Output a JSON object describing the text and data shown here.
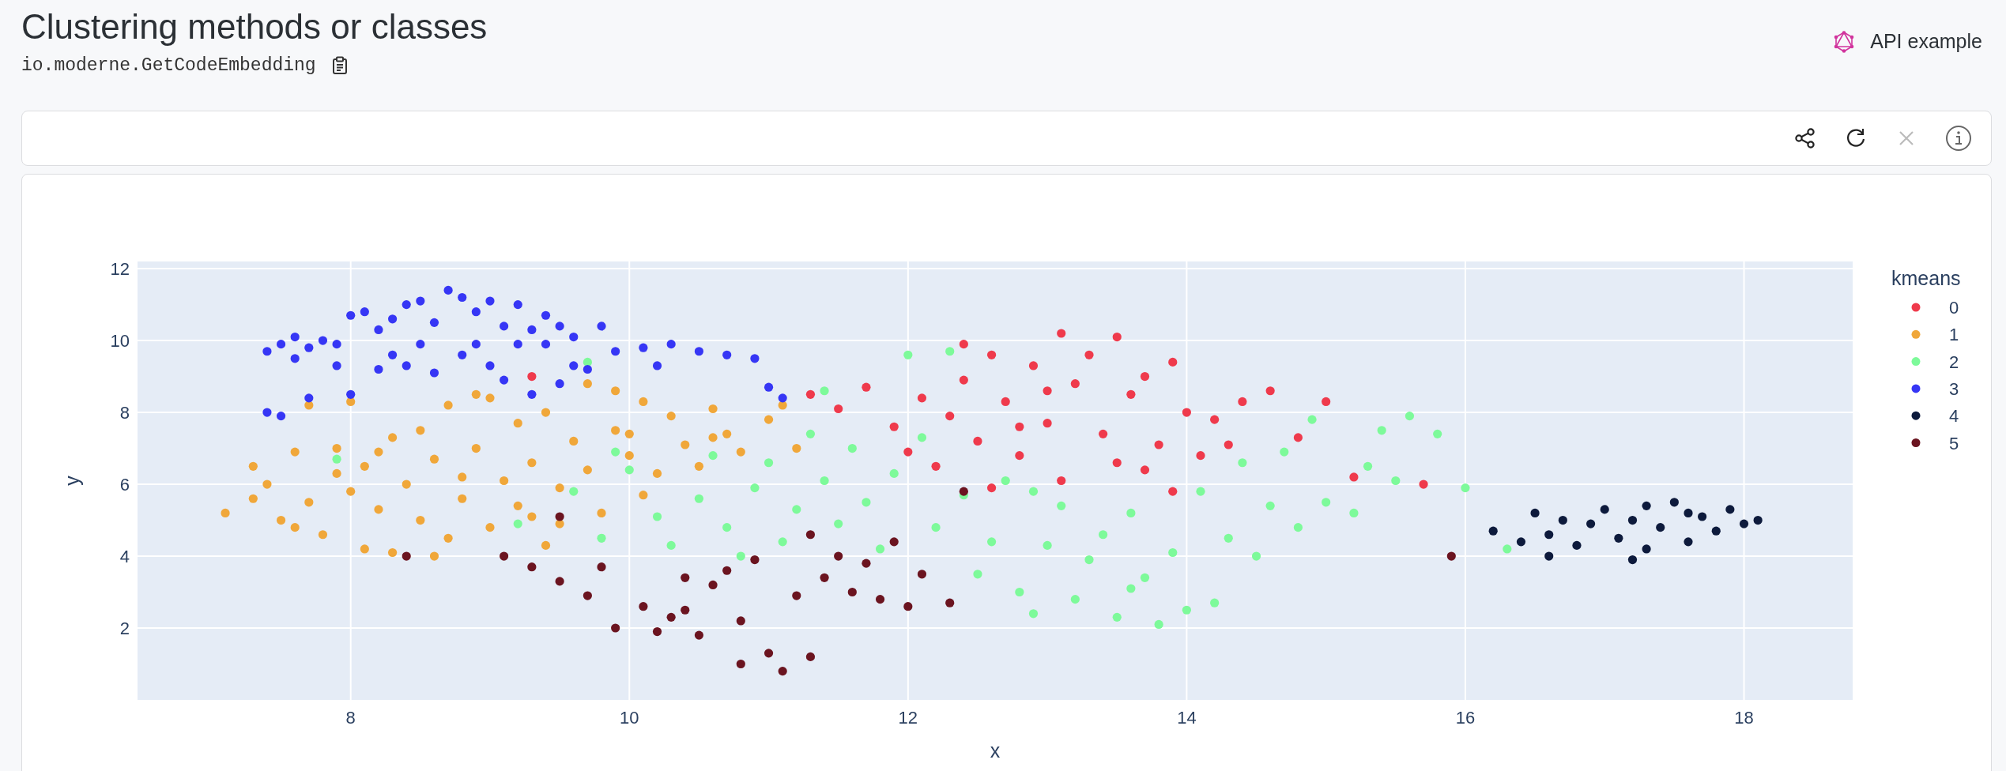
{
  "header": {
    "title": "Clustering methods or classes",
    "subtitle": "io.moderne.GetCodeEmbedding",
    "link": "API example"
  },
  "toolbar": [
    {
      "kind": "share",
      "disabled": false
    },
    {
      "kind": "refresh",
      "disabled": false
    },
    {
      "kind": "close",
      "disabled": true
    },
    {
      "kind": "info",
      "disabled": false
    }
  ],
  "chart": {
    "chart_data": {
      "type": "scatter",
      "xlabel": "x",
      "ylabel": "y",
      "grid": true,
      "legend": {
        "title": "kmeans"
      },
      "xlim": [
        6.47,
        18.78
      ],
      "ylim": [
        0,
        12.2
      ],
      "xticks": [
        8,
        10,
        12,
        14,
        16,
        18
      ],
      "yticks": [
        2,
        4,
        6,
        8,
        10,
        12
      ],
      "series": [
        {
          "name": "0",
          "color": "#ef3a4c",
          "x": [
            11.3,
            11.5,
            11.7,
            11.9,
            12.1,
            12.2,
            12.3,
            12.4,
            12.5,
            12.6,
            12.7,
            12.8,
            12.9,
            13.0,
            13.1,
            13.1,
            13.2,
            13.3,
            13.4,
            13.5,
            13.5,
            13.6,
            13.7,
            13.8,
            13.9,
            14.0,
            14.1,
            14.2,
            14.4,
            14.6,
            14.8,
            15.0,
            15.2,
            15.7,
            12.0,
            12.6,
            13.9,
            14.3,
            12.4,
            13.0,
            13.7,
            12.8,
            9.3
          ],
          "values": [
            8.5,
            8.1,
            8.7,
            7.6,
            8.4,
            6.5,
            7.9,
            8.9,
            7.2,
            9.6,
            8.3,
            6.8,
            9.3,
            7.7,
            10.2,
            6.1,
            8.8,
            9.6,
            7.4,
            10.1,
            6.6,
            8.5,
            9.0,
            7.1,
            9.4,
            8.0,
            6.8,
            7.8,
            8.3,
            8.6,
            7.3,
            8.3,
            6.2,
            6.0,
            6.9,
            5.9,
            5.8,
            7.1,
            9.9,
            8.6,
            6.4,
            7.6,
            9.0
          ]
        },
        {
          "name": "1",
          "color": "#f0a73a",
          "x": [
            7.1,
            7.3,
            7.4,
            7.5,
            7.6,
            7.6,
            7.7,
            7.8,
            7.9,
            7.9,
            8.0,
            8.1,
            8.1,
            8.2,
            8.3,
            8.3,
            8.4,
            8.5,
            8.5,
            8.6,
            8.7,
            8.7,
            8.8,
            8.8,
            8.9,
            9.0,
            9.0,
            9.1,
            9.2,
            9.2,
            9.3,
            9.4,
            9.4,
            9.5,
            9.6,
            9.7,
            9.7,
            9.8,
            9.9,
            10.0,
            10.1,
            10.1,
            10.2,
            10.3,
            10.4,
            10.5,
            10.6,
            10.7,
            10.8,
            11.0,
            11.1,
            11.2,
            9.9,
            8.9,
            8.0,
            7.7,
            9.5,
            10.0,
            8.6,
            9.3,
            8.2,
            7.3,
            10.6
          ],
          "values": [
            5.2,
            6.5,
            6.0,
            5.0,
            4.8,
            6.9,
            5.5,
            4.6,
            6.3,
            7.0,
            5.8,
            4.2,
            6.5,
            5.3,
            7.3,
            4.1,
            6.0,
            5.0,
            7.5,
            6.7,
            4.5,
            8.2,
            6.2,
            5.6,
            7.0,
            8.4,
            4.8,
            6.1,
            5.4,
            7.7,
            6.6,
            8.0,
            4.3,
            5.9,
            7.2,
            6.4,
            8.8,
            5.2,
            7.5,
            6.8,
            8.3,
            5.7,
            6.3,
            7.9,
            7.1,
            6.5,
            8.1,
            7.4,
            6.9,
            7.8,
            8.2,
            7.0,
            8.6,
            8.5,
            8.3,
            8.2,
            4.9,
            7.4,
            4.0,
            5.1,
            6.9,
            5.6,
            7.3
          ]
        },
        {
          "name": "2",
          "color": "#7dfa9a",
          "x": [
            9.6,
            9.8,
            10.0,
            10.2,
            10.3,
            10.5,
            10.6,
            10.7,
            10.9,
            11.0,
            11.1,
            11.2,
            11.3,
            11.4,
            11.5,
            11.6,
            11.7,
            11.8,
            11.9,
            12.0,
            12.1,
            12.2,
            12.3,
            12.4,
            12.5,
            12.6,
            12.7,
            12.8,
            12.9,
            13.0,
            13.1,
            13.2,
            13.3,
            13.4,
            13.5,
            13.6,
            13.7,
            13.8,
            13.9,
            14.0,
            14.1,
            14.2,
            14.3,
            14.4,
            14.5,
            14.6,
            14.7,
            14.8,
            15.0,
            15.2,
            15.4,
            15.5,
            15.6,
            15.8,
            16.0,
            16.3,
            14.9,
            15.3,
            12.9,
            11.4,
            10.8,
            9.9,
            13.6,
            7.9,
            9.2,
            9.7
          ],
          "values": [
            5.8,
            4.5,
            6.4,
            5.1,
            4.3,
            5.6,
            6.8,
            4.8,
            5.9,
            6.6,
            4.4,
            5.3,
            7.4,
            6.1,
            4.9,
            7.0,
            5.5,
            4.2,
            6.3,
            9.6,
            7.3,
            4.8,
            9.7,
            5.7,
            3.5,
            4.4,
            6.1,
            3.0,
            2.4,
            4.3,
            5.4,
            2.8,
            3.9,
            4.6,
            2.3,
            5.2,
            3.4,
            2.1,
            4.1,
            2.5,
            5.8,
            2.7,
            4.5,
            6.6,
            4.0,
            5.4,
            6.9,
            4.8,
            5.5,
            5.2,
            7.5,
            6.1,
            7.9,
            7.4,
            5.9,
            4.2,
            7.8,
            6.5,
            5.8,
            8.6,
            4.0,
            6.9,
            3.1,
            6.7,
            4.9,
            9.4
          ]
        },
        {
          "name": "3",
          "color": "#3636f5",
          "x": [
            7.4,
            7.5,
            7.6,
            7.7,
            7.8,
            7.9,
            7.6,
            8.0,
            8.1,
            8.2,
            8.3,
            8.4,
            8.5,
            8.6,
            8.7,
            8.8,
            8.9,
            9.0,
            9.1,
            9.2,
            9.3,
            9.4,
            9.5,
            9.6,
            9.8,
            9.9,
            10.1,
            10.3,
            10.5,
            10.7,
            11.0,
            7.4,
            7.5,
            7.7,
            8.2,
            8.5,
            8.8,
            9.0,
            9.1,
            9.3,
            9.5,
            9.7,
            8.4,
            8.9,
            9.2,
            7.9,
            8.6,
            9.4,
            8.0,
            10.2,
            10.9,
            11.1,
            8.3,
            9.6
          ],
          "values": [
            9.7,
            9.9,
            10.1,
            9.8,
            10.0,
            9.3,
            9.5,
            10.7,
            10.8,
            10.3,
            10.6,
            11.0,
            11.1,
            10.5,
            11.4,
            11.2,
            10.8,
            11.1,
            10.4,
            11.0,
            10.3,
            9.9,
            10.4,
            9.3,
            10.4,
            9.7,
            9.8,
            9.9,
            9.7,
            9.6,
            8.7,
            8.0,
            7.9,
            8.4,
            9.2,
            9.9,
            9.6,
            9.3,
            8.9,
            8.5,
            8.8,
            9.2,
            9.3,
            9.9,
            9.9,
            9.9,
            9.1,
            10.7,
            8.5,
            9.3,
            9.5,
            8.4,
            9.6,
            10.1
          ]
        },
        {
          "name": "4",
          "color": "#0d1a3c",
          "x": [
            16.2,
            16.4,
            16.5,
            16.6,
            16.7,
            16.8,
            16.9,
            17.0,
            17.1,
            17.2,
            17.3,
            17.3,
            17.4,
            17.5,
            17.6,
            17.7,
            17.8,
            17.9,
            18.0,
            18.1,
            17.2,
            16.6,
            17.6
          ],
          "values": [
            4.7,
            4.4,
            5.2,
            4.6,
            5.0,
            4.3,
            4.9,
            5.3,
            4.5,
            5.0,
            4.2,
            5.4,
            4.8,
            5.5,
            4.4,
            5.1,
            4.7,
            5.3,
            4.9,
            5.0,
            3.9,
            4.0,
            5.2
          ]
        },
        {
          "name": "5",
          "color": "#6b1420",
          "x": [
            9.1,
            9.3,
            9.5,
            9.7,
            9.8,
            9.9,
            10.1,
            10.2,
            10.3,
            10.4,
            10.5,
            10.6,
            10.7,
            10.8,
            10.8,
            10.9,
            11.0,
            11.1,
            11.2,
            11.3,
            11.4,
            11.5,
            11.6,
            11.7,
            11.8,
            11.9,
            12.0,
            12.1,
            12.3,
            12.4,
            11.3,
            8.4,
            9.5,
            15.9,
            10.4
          ],
          "values": [
            4.0,
            3.7,
            3.3,
            2.9,
            3.7,
            2.0,
            2.6,
            1.9,
            2.3,
            2.5,
            1.8,
            3.2,
            3.6,
            2.2,
            1.0,
            3.9,
            1.3,
            0.8,
            2.9,
            1.2,
            3.4,
            4.0,
            3.0,
            3.8,
            2.8,
            4.4,
            2.6,
            3.5,
            2.7,
            5.8,
            4.6,
            4.0,
            5.1,
            4.0,
            3.4
          ]
        }
      ]
    }
  }
}
